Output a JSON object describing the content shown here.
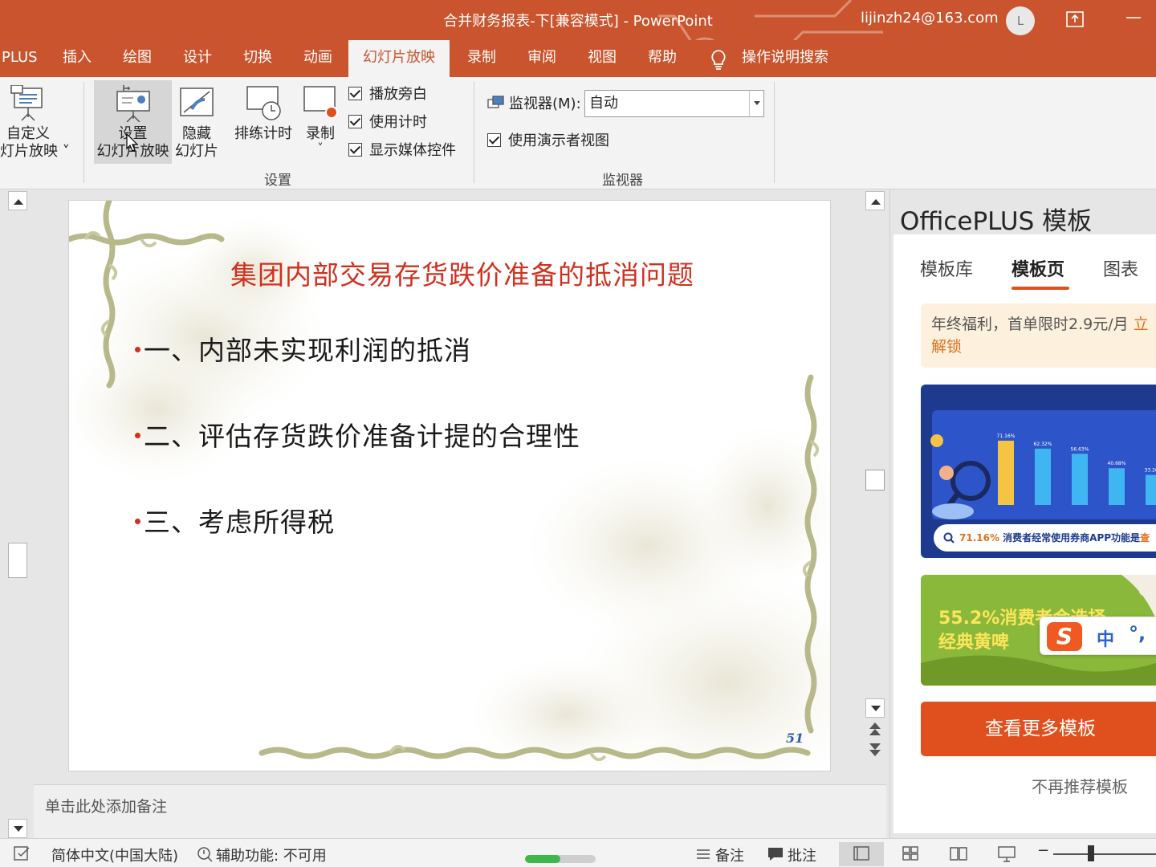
{
  "window": {
    "title": "合并财务报表-下[兼容模式]  -  PowerPoint",
    "account": "lijinzh24@163.com",
    "avatar_initial": "L"
  },
  "tabs": [
    {
      "label": "PLUS"
    },
    {
      "label": "插入"
    },
    {
      "label": "绘图"
    },
    {
      "label": "设计"
    },
    {
      "label": "切换"
    },
    {
      "label": "动画"
    },
    {
      "label": "幻灯片放映",
      "active": true
    },
    {
      "label": "录制"
    },
    {
      "label": "审阅"
    },
    {
      "label": "视图"
    },
    {
      "label": "帮助"
    },
    {
      "label": "操作说明搜索"
    }
  ],
  "ribbon": {
    "custom_show": {
      "line1": "自定义",
      "line2": "灯片放映 ˅"
    },
    "setup_show": {
      "line1": "设置",
      "line2": "幻灯片放映"
    },
    "hide_slide": {
      "line1": "隐藏",
      "line2": "幻灯片"
    },
    "rehearse": {
      "line1": "排练计时"
    },
    "record": {
      "line1": "录制",
      "line2": "˅"
    },
    "checks": {
      "play_narration": "播放旁白",
      "use_timings": "使用计时",
      "show_media_controls": "显示媒体控件",
      "use_presenter_view": "使用演示者视图"
    },
    "group_setup_label": "设置",
    "monitor_label": "监视器(M):",
    "monitor_value": "自动",
    "group_monitor_label": "监视器"
  },
  "slide": {
    "title": "集团内部交易存货跌价准备的抵消问题",
    "bullets": [
      "一、内部未实现利润的抵消",
      "二、评估存货跌价准备计提的合理性",
      "三、考虑所得税"
    ],
    "number": "51"
  },
  "notes": {
    "placeholder": "单击此处添加备注"
  },
  "pane": {
    "title": "OfficePLUS 模板",
    "tabs": [
      "模板库",
      "模板页",
      "图表"
    ],
    "active_tab": "模板页",
    "promo_line1": "年终福利，首单限时2.9元/月 ",
    "promo_link": "立",
    "promo_line2": "解锁",
    "card1": {
      "pct": "71.16%",
      "text": "消费者经常使用券商APP功能是",
      "link": "查",
      "bar_labels": [
        "71.16%",
        "62.32%",
        "56.63%",
        "40.68%",
        "33.26%"
      ],
      "bar_values": [
        71.16,
        62.32,
        56.63,
        40.68,
        33.26
      ]
    },
    "card2": {
      "line1": "55.2%消费者会选择",
      "line2": "经典黄啤"
    },
    "cta": "查看更多模板",
    "no_more": "不再推荐模板"
  },
  "ime": {
    "mode": "中",
    "punct": "°,"
  },
  "status": {
    "language": "简体中文(中国大陆)",
    "accessibility": "辅助功能: 不可用",
    "notes": "备注",
    "comments": "批注",
    "progress": 0.5
  },
  "colors": {
    "accent": "#c9542e",
    "slide_title": "#d0301f",
    "cta": "#e0501e"
  }
}
